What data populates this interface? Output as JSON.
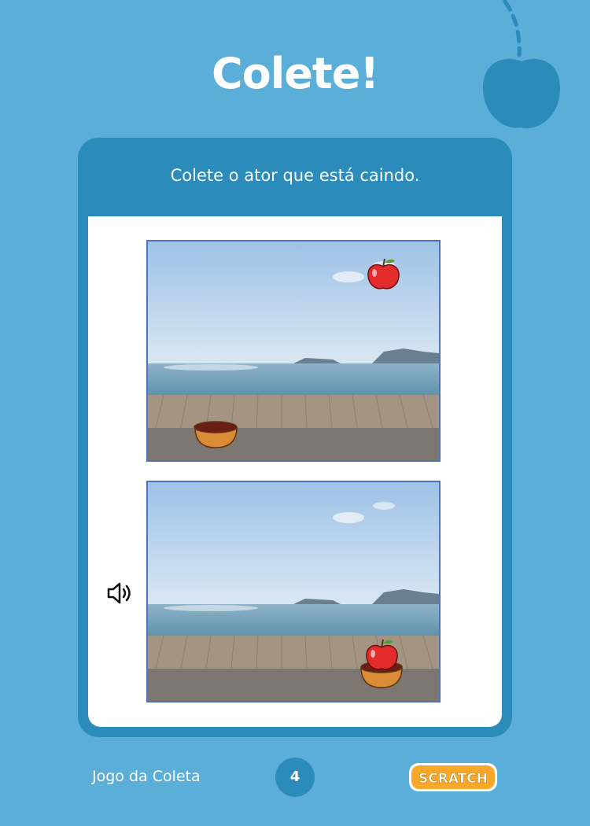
{
  "page": {
    "title": "Colete!",
    "background_color": "#5aaed8",
    "accent_color": "#2b8cbb"
  },
  "card": {
    "subtitle": "Colete o ator que está caindo."
  },
  "scenes": [
    {
      "name": "apple-falling",
      "sprites": [
        "apple",
        "bowl"
      ]
    },
    {
      "name": "apple-caught",
      "sprites": [
        "apple",
        "bowl"
      ]
    }
  ],
  "icons": {
    "sound": "speaker-icon",
    "decoration": "apple-icon"
  },
  "footer": {
    "label": "Jogo da Coleta",
    "page_number": "4",
    "logo_text": "SCRATCH"
  }
}
